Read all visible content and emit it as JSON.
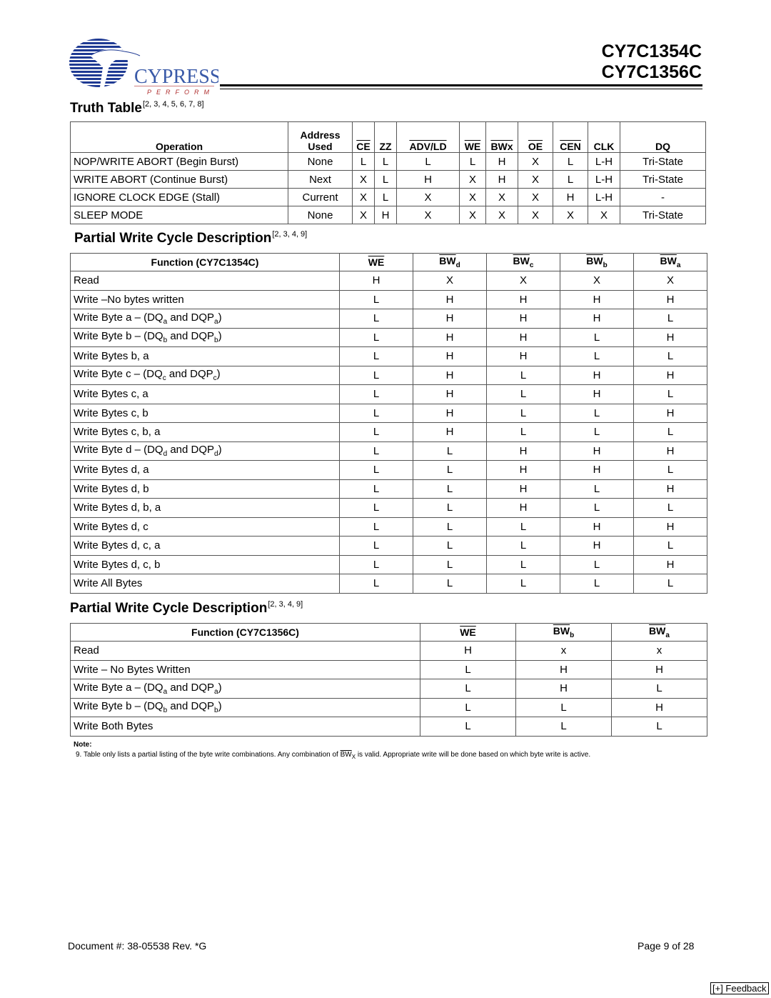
{
  "header": {
    "logo_brand": "CYPRESS",
    "logo_tagline": "PERFORM",
    "part_numbers": [
      "CY7C1354C",
      "CY7C1356C"
    ]
  },
  "truth_table": {
    "title": "Truth Table",
    "refs": "[2, 3, 4, 5, 6, 7, 8]",
    "columns": [
      {
        "label": "Operation",
        "overbar": false
      },
      {
        "label": "Address Used",
        "overbar": false
      },
      {
        "label": "CE",
        "overbar": true
      },
      {
        "label": "ZZ",
        "overbar": false
      },
      {
        "label": "ADV/LD",
        "overbar": true
      },
      {
        "label": "WE",
        "overbar": true
      },
      {
        "label": "BWx",
        "overbar": true
      },
      {
        "label": "OE",
        "overbar": true
      },
      {
        "label": "CEN",
        "overbar": true
      },
      {
        "label": "CLK",
        "overbar": false
      },
      {
        "label": "DQ",
        "overbar": false
      }
    ],
    "rows": [
      [
        "NOP/WRITE ABORT (Begin Burst)",
        "None",
        "L",
        "L",
        "L",
        "L",
        "H",
        "X",
        "L",
        "L-H",
        "Tri-State"
      ],
      [
        "WRITE ABORT (Continue Burst)",
        "Next",
        "X",
        "L",
        "H",
        "X",
        "H",
        "X",
        "L",
        "L-H",
        "Tri-State"
      ],
      [
        "IGNORE CLOCK EDGE (Stall)",
        "Current",
        "X",
        "L",
        "X",
        "X",
        "X",
        "X",
        "H",
        "L-H",
        "-"
      ],
      [
        "SLEEP MODE",
        "None",
        "X",
        "H",
        "X",
        "X",
        "X",
        "X",
        "X",
        "X",
        "Tri-State"
      ]
    ]
  },
  "pwc_1354": {
    "title": "Partial Write Cycle Description",
    "refs": "[2, 3, 4, 9]",
    "columns": [
      {
        "label": "Function (CY7C1354C)",
        "sub": ""
      },
      {
        "label": "WE",
        "sub": ""
      },
      {
        "label": "BW",
        "sub": "d"
      },
      {
        "label": "BW",
        "sub": "c"
      },
      {
        "label": "BW",
        "sub": "b"
      },
      {
        "label": "BW",
        "sub": "a"
      }
    ],
    "rows": [
      {
        "fn": "Read",
        "values": [
          "H",
          "X",
          "X",
          "X",
          "X"
        ]
      },
      {
        "fn": "Write –No bytes written",
        "values": [
          "L",
          "H",
          "H",
          "H",
          "H"
        ]
      },
      {
        "fn": "Write Byte a – (DQ_a and DQP_a)",
        "values": [
          "L",
          "H",
          "H",
          "H",
          "L"
        ]
      },
      {
        "fn": "Write Byte b – (DQ_b and DQP_b)",
        "values": [
          "L",
          "H",
          "H",
          "L",
          "H"
        ]
      },
      {
        "fn": "Write Bytes b, a",
        "values": [
          "L",
          "H",
          "H",
          "L",
          "L"
        ]
      },
      {
        "fn": "Write Byte c – (DQ_c and DQP_c)",
        "values": [
          "L",
          "H",
          "L",
          "H",
          "H"
        ]
      },
      {
        "fn": "Write Bytes c, a",
        "values": [
          "L",
          "H",
          "L",
          "H",
          "L"
        ]
      },
      {
        "fn": "Write Bytes c, b",
        "values": [
          "L",
          "H",
          "L",
          "L",
          "H"
        ]
      },
      {
        "fn": "Write Bytes c, b, a",
        "values": [
          "L",
          "H",
          "L",
          "L",
          "L"
        ]
      },
      {
        "fn": "Write Byte d – (DQ_d and DQP_d)",
        "values": [
          "L",
          "L",
          "H",
          "H",
          "H"
        ]
      },
      {
        "fn": "Write Bytes d, a",
        "values": [
          "L",
          "L",
          "H",
          "H",
          "L"
        ]
      },
      {
        "fn": "Write Bytes d, b",
        "values": [
          "L",
          "L",
          "H",
          "L",
          "H"
        ]
      },
      {
        "fn": "Write Bytes d, b, a",
        "values": [
          "L",
          "L",
          "H",
          "L",
          "L"
        ]
      },
      {
        "fn": "Write Bytes d, c",
        "values": [
          "L",
          "L",
          "L",
          "H",
          "H"
        ]
      },
      {
        "fn": "Write Bytes d, c, a",
        "values": [
          "L",
          "L",
          "L",
          "H",
          "L"
        ]
      },
      {
        "fn": "Write Bytes d, c, b",
        "values": [
          "L",
          "L",
          "L",
          "L",
          "H"
        ]
      },
      {
        "fn": "Write All Bytes",
        "values": [
          "L",
          "L",
          "L",
          "L",
          "L"
        ]
      }
    ]
  },
  "pwc_1356": {
    "title": "Partial Write Cycle Description",
    "refs": "[2, 3, 4, 9]",
    "columns": [
      {
        "label": "Function (CY7C1356C)",
        "sub": ""
      },
      {
        "label": "WE",
        "sub": ""
      },
      {
        "label": "BW",
        "sub": "b"
      },
      {
        "label": "BW",
        "sub": "a"
      }
    ],
    "rows": [
      {
        "fn": "Read",
        "values": [
          "H",
          "x",
          "x"
        ]
      },
      {
        "fn": "Write – No Bytes Written",
        "values": [
          "L",
          "H",
          "H"
        ]
      },
      {
        "fn": "Write Byte a – (DQ_a and DQP_a)",
        "values": [
          "L",
          "H",
          "L"
        ]
      },
      {
        "fn": "Write Byte b – (DQ_b and DQP_b)",
        "values": [
          "L",
          "L",
          "H"
        ]
      },
      {
        "fn": "Write Both Bytes",
        "values": [
          "L",
          "L",
          "L"
        ]
      }
    ]
  },
  "notes": {
    "title": "Note:",
    "items": [
      {
        "num": "9.",
        "pre": "Table only lists a partial listing of the byte write combinations. Any combination of ",
        "sym": "BW",
        "sym_sub": "X",
        "post": " is valid. Appropriate write will be done based on which byte write is active."
      }
    ]
  },
  "footer": {
    "document": "Document #: 38-05538 Rev. *G",
    "page": "Page 9 of 28",
    "feedback": "[+] Feedback"
  }
}
